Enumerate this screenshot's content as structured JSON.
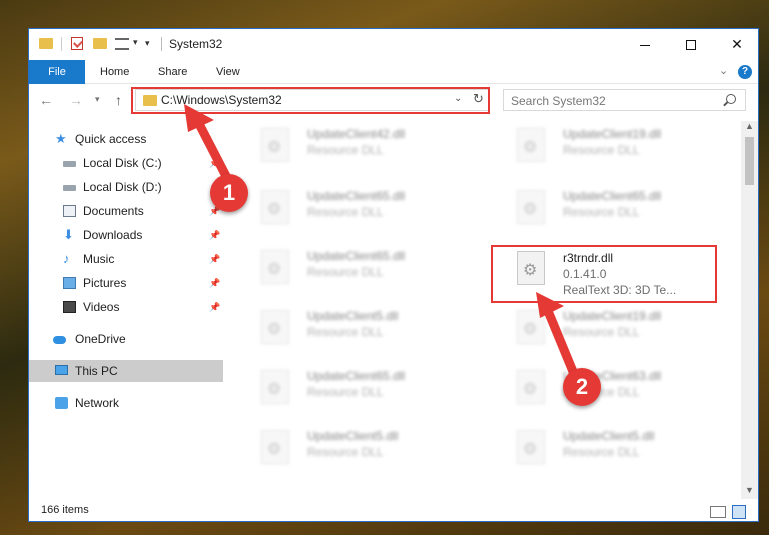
{
  "window": {
    "title": "System32"
  },
  "ribbon": {
    "tabs": [
      "File",
      "Home",
      "Share",
      "View"
    ]
  },
  "navbar": {
    "address": "C:\\Windows\\System32",
    "search_placeholder": "Search System32"
  },
  "sidebar": {
    "items": [
      {
        "label": "Quick access",
        "icon": "star-icon",
        "pinned": false
      },
      {
        "label": "Local Disk (C:)",
        "icon": "drive-icon",
        "pinned": true
      },
      {
        "label": "Local Disk (D:)",
        "icon": "drive-icon",
        "pinned": true
      },
      {
        "label": "Documents",
        "icon": "documents-icon",
        "pinned": true
      },
      {
        "label": "Downloads",
        "icon": "downloads-icon",
        "pinned": true
      },
      {
        "label": "Music",
        "icon": "music-icon",
        "pinned": true
      },
      {
        "label": "Pictures",
        "icon": "pictures-icon",
        "pinned": true
      },
      {
        "label": "Videos",
        "icon": "videos-icon",
        "pinned": true
      },
      {
        "label": "OneDrive",
        "icon": "onedrive-icon",
        "pinned": false
      },
      {
        "label": "This PC",
        "icon": "this-pc-icon",
        "pinned": false,
        "selected": true
      },
      {
        "label": "Network",
        "icon": "network-icon",
        "pinned": false
      }
    ]
  },
  "files": {
    "left": [
      {
        "name": "UpdateClient42.dll",
        "desc": "Resource DLL"
      },
      {
        "name": "UpdateClient65.dll",
        "desc": "Resource DLL"
      },
      {
        "name": "UpdateClient65.dll",
        "desc": "Resource DLL"
      },
      {
        "name": "UpdateClient5.dll",
        "desc": "Resource DLL"
      },
      {
        "name": "UpdateClient65.dll",
        "desc": "Resource DLL"
      },
      {
        "name": "UpdateClient5.dll",
        "desc": "Resource DLL"
      }
    ],
    "right": [
      {
        "name": "UpdateClient19.dll",
        "desc": "Resource DLL"
      },
      {
        "name": "UpdateClient65.dll",
        "desc": "Resource DLL"
      },
      {
        "name": "UpdateClient19.dll",
        "desc": "Resource DLL"
      },
      {
        "name": "UpdateClient63.dll",
        "desc": "Resource DLL"
      },
      {
        "name": "UpdateClient5.dll",
        "desc": "Resource DLL"
      }
    ],
    "highlighted": {
      "name": "r3trndr.dll",
      "version": "0.1.41.0",
      "desc": "RealText 3D:   3D Te..."
    }
  },
  "status": {
    "item_count": "166 items"
  },
  "callouts": [
    "1",
    "2"
  ],
  "colors": {
    "accent": "#1979ca",
    "highlight": "#e53935"
  }
}
